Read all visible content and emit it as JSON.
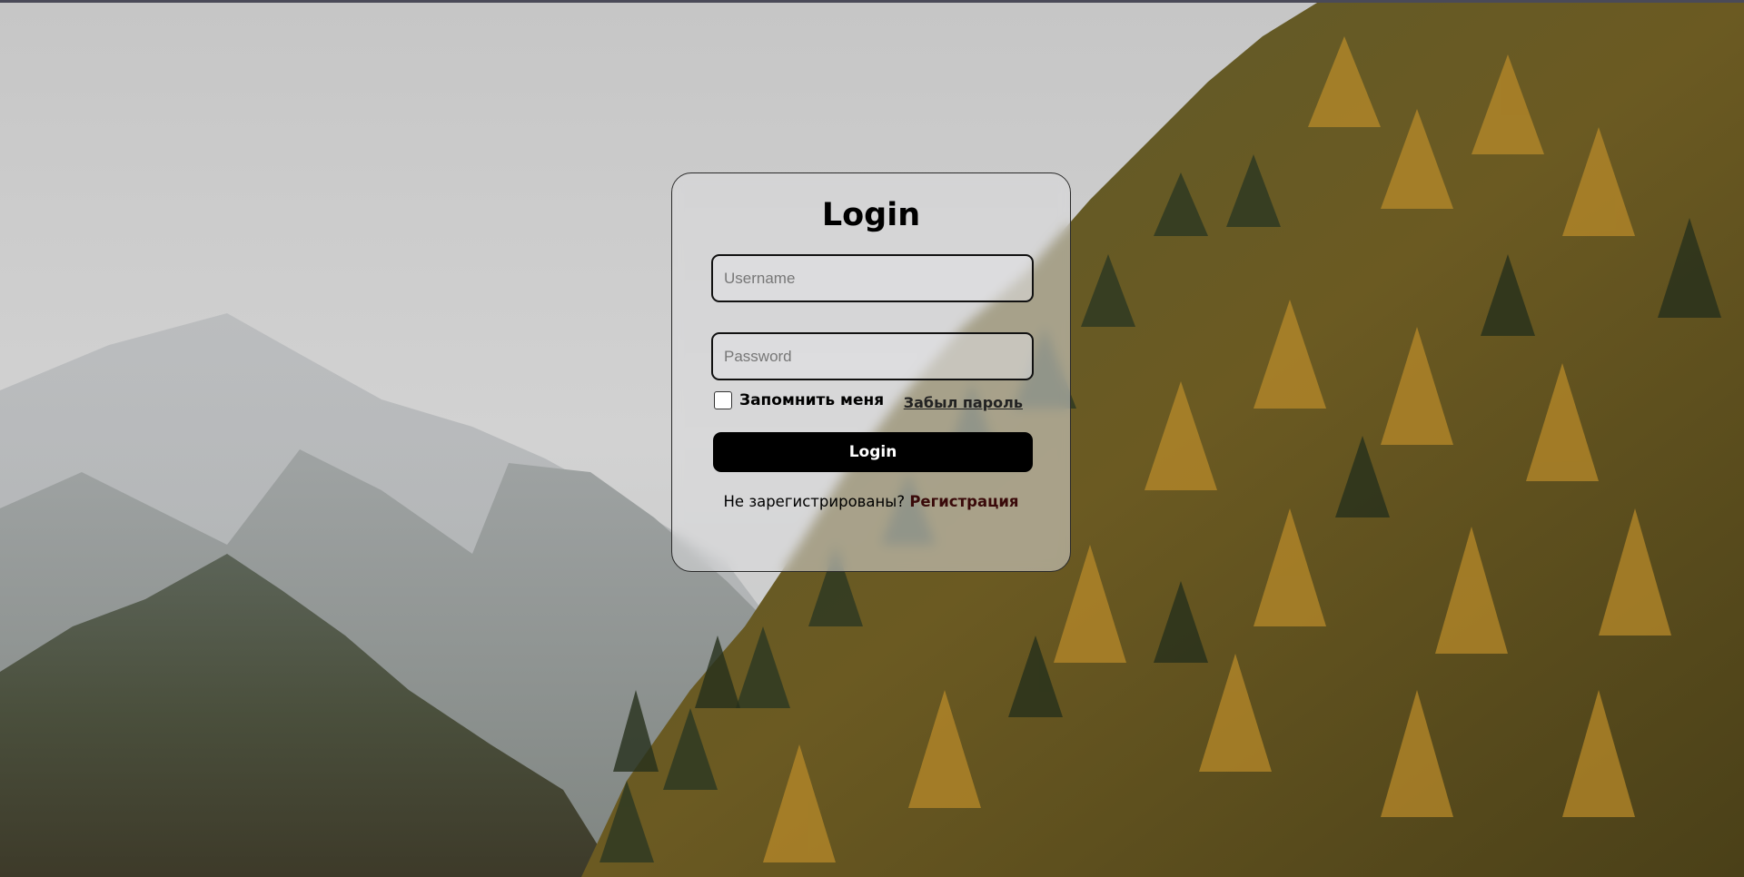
{
  "login_form": {
    "title": "Login",
    "username_placeholder": "Username",
    "username_value": "",
    "password_placeholder": "Password",
    "password_value": "",
    "remember_label": "Запомнить меня",
    "remember_checked": false,
    "forgot_label": "Забыл пароль",
    "submit_label": "Login",
    "register_prompt": "Не зарегистрированы?",
    "register_link": "Регистрация"
  },
  "colors": {
    "button_bg": "#000000",
    "button_text": "#ffffff",
    "register_link": "#3a0a0a",
    "card_border": "#2a2a2a"
  }
}
